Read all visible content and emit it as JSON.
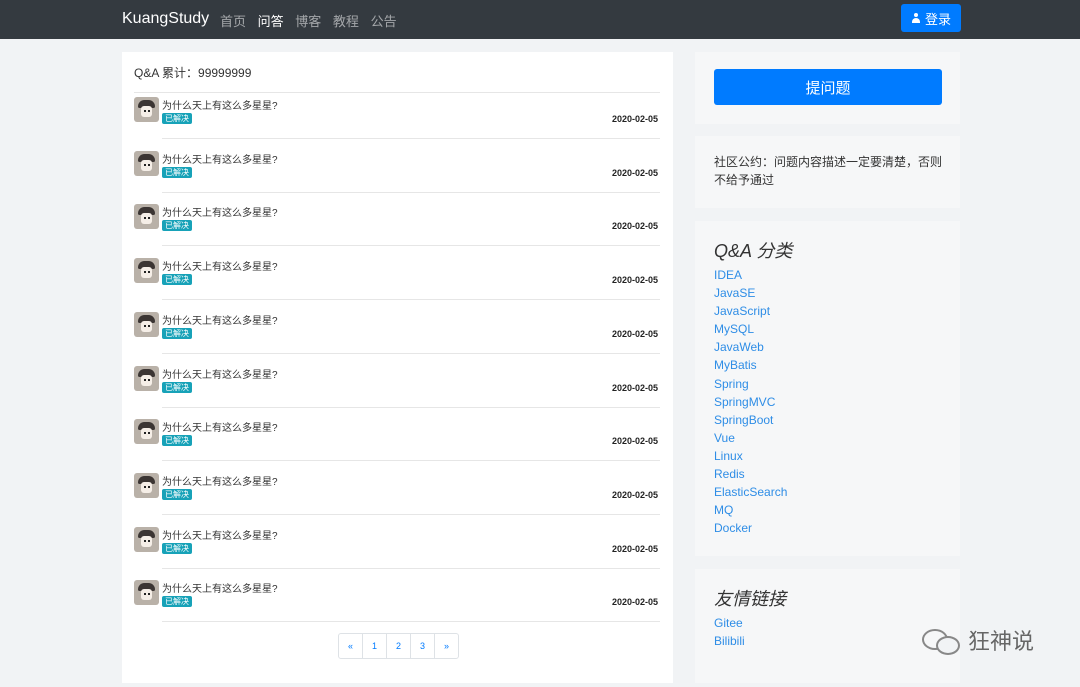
{
  "navbar": {
    "brand": "KuangStudy",
    "links": [
      "首页",
      "问答",
      "博客",
      "教程",
      "公告"
    ],
    "login_label": "登录"
  },
  "qa": {
    "total_label": "Q&A 累计：99999999",
    "questions": [
      {
        "title": "为什么天上有这么多星星?",
        "status": "已解决",
        "date": "2020-02-05"
      },
      {
        "title": "为什么天上有这么多星星?",
        "status": "已解决",
        "date": "2020-02-05"
      },
      {
        "title": "为什么天上有这么多星星?",
        "status": "已解决",
        "date": "2020-02-05"
      },
      {
        "title": "为什么天上有这么多星星?",
        "status": "已解决",
        "date": "2020-02-05"
      },
      {
        "title": "为什么天上有这么多星星?",
        "status": "已解决",
        "date": "2020-02-05"
      },
      {
        "title": "为什么天上有这么多星星?",
        "status": "已解决",
        "date": "2020-02-05"
      },
      {
        "title": "为什么天上有这么多星星?",
        "status": "已解决",
        "date": "2020-02-05"
      },
      {
        "title": "为什么天上有这么多星星?",
        "status": "已解决",
        "date": "2020-02-05"
      },
      {
        "title": "为什么天上有这么多星星?",
        "status": "已解决",
        "date": "2020-02-05"
      },
      {
        "title": "为什么天上有这么多星星?",
        "status": "已解决",
        "date": "2020-02-05"
      }
    ],
    "pagination": [
      "«",
      "1",
      "2",
      "3",
      "»"
    ]
  },
  "sidebar": {
    "ask_label": "提问题",
    "notice": "社区公约：问题内容描述一定要清楚，否则不给予通过",
    "category_title": "Q&A 分类",
    "categories": [
      "IDEA",
      "JavaSE",
      "JavaScript",
      "MySQL",
      "JavaWeb",
      "MyBatis",
      "Spring",
      "SpringMVC",
      "SpringBoot",
      "Vue",
      "Linux",
      "Redis",
      "ElasticSearch",
      "MQ",
      "Docker"
    ],
    "links_title": "友情链接",
    "links": [
      "Gitee",
      "Bilibili"
    ]
  },
  "watermark": "狂神说",
  "colors": {
    "primary": "#007bff",
    "navbar": "#343a40",
    "badge": "#17a2b8",
    "link": "#2e8de6"
  }
}
